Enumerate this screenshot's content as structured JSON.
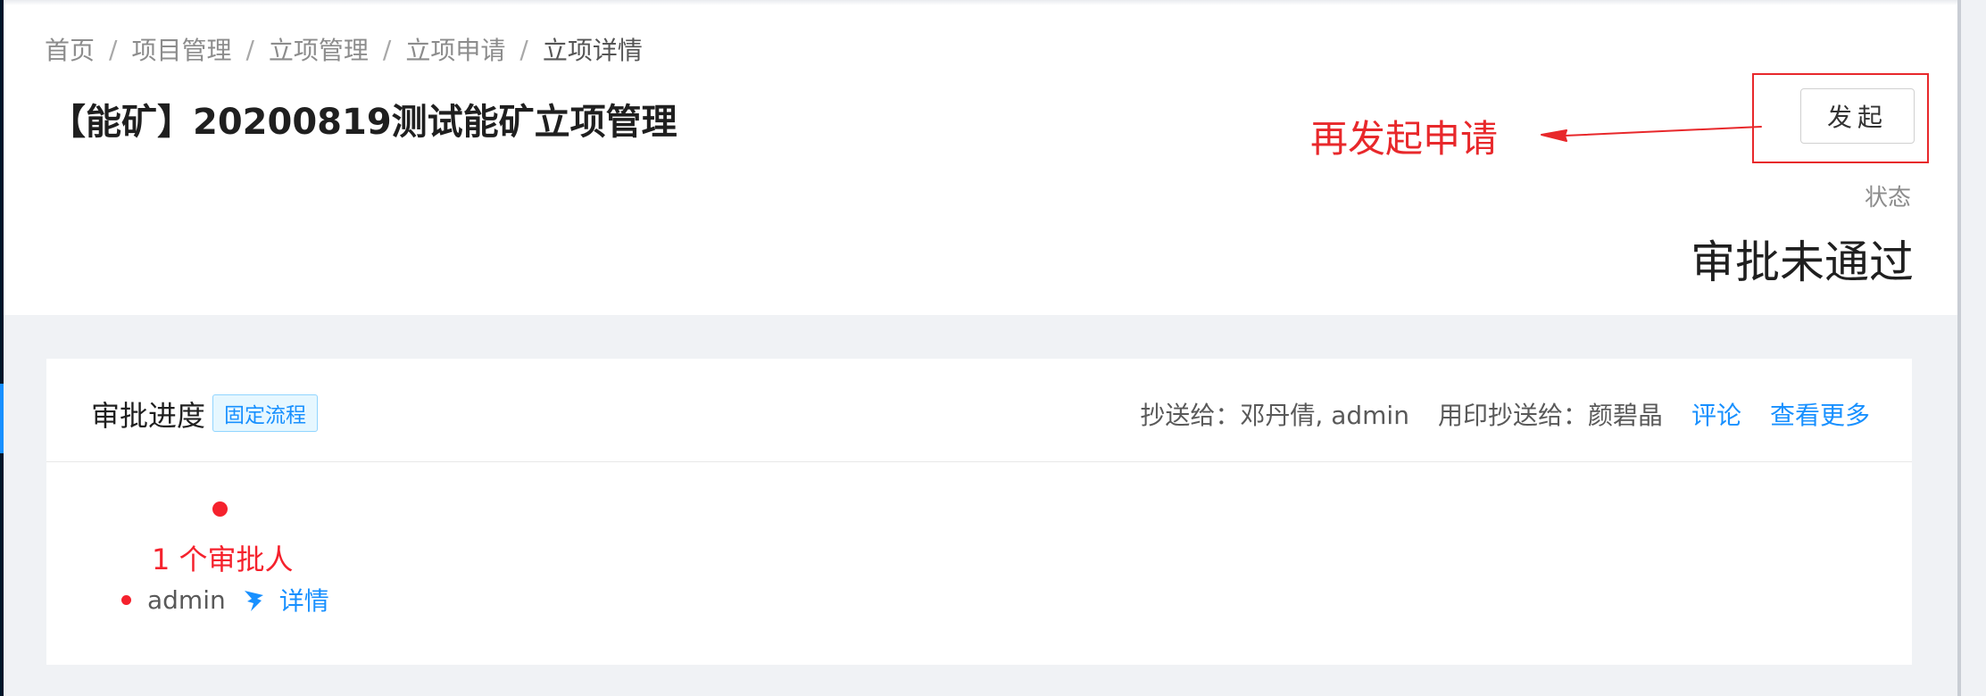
{
  "breadcrumb": {
    "items": [
      "首页",
      "项目管理",
      "立项管理",
      "立项申请",
      "立项详情"
    ],
    "separator": "/"
  },
  "page": {
    "title": "【能矿】20200819测试能矿立项管理"
  },
  "actions": {
    "launch_label": "发起"
  },
  "annotation": {
    "text": "再发起申请",
    "color": "#e8282b"
  },
  "status": {
    "label": "状态",
    "value": "审批未通过"
  },
  "approval": {
    "title": "审批进度",
    "tag": "固定流程",
    "cc": "抄送给：邓丹倩, admin",
    "seal_cc": "用印抄送给：颜碧晶",
    "comment_link": "评论",
    "more_link": "查看更多",
    "approver_count": "1 个审批人",
    "approver_name": "admin",
    "detail_link": "详情"
  },
  "colors": {
    "accent": "#1890ff",
    "danger": "#f5222d",
    "background": "#f0f2f5"
  },
  "icons": {
    "approver": "dingtalk-icon"
  }
}
